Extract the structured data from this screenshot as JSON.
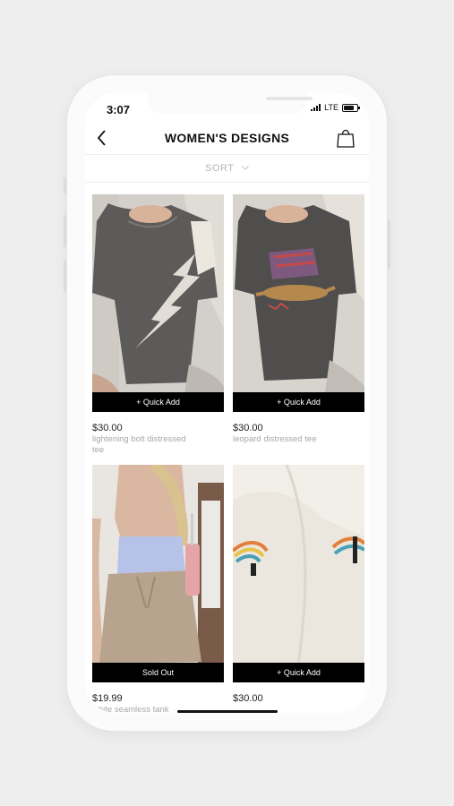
{
  "status": {
    "time": "3:07",
    "network": "LTE"
  },
  "nav": {
    "title": "WOMEN'S DESIGNS"
  },
  "sort": {
    "label": "SORT"
  },
  "products": [
    {
      "price": "$30.00",
      "name": "lightening bolt distressed tee",
      "action": "+ Quick Add"
    },
    {
      "price": "$30.00",
      "name": "leopard distressed tee",
      "action": "+ Quick Add"
    },
    {
      "price": "$19.99",
      "name": "white seamless tank",
      "action": "Sold Out"
    },
    {
      "price": "$30.00",
      "name": "",
      "action": "+ Quick Add"
    }
  ],
  "icons": {
    "back": "chevron-left-icon",
    "cart": "shopping-bag-icon",
    "sort": "chevron-down-icon"
  }
}
